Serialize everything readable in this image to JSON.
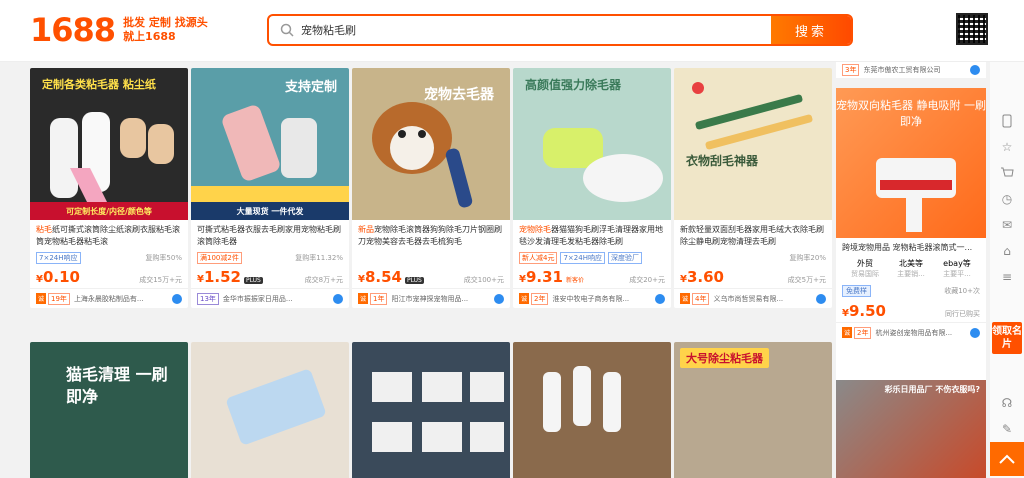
{
  "header": {
    "logo_text": "1688",
    "slogan_line1": "批发 定制 找源头",
    "slogan_line2": "就上1688",
    "search_value": "宠物粘毛刷",
    "search_button": "搜索"
  },
  "products": [
    {
      "image_text": "定制各类粘毛器 粘尘纸",
      "image_sub": "可定制长度/内径/颜色等",
      "title_hl": "粘毛",
      "title_rest": "纸可撕式滚筒除尘纸滚刷衣服粘毛滚筒宠物粘毛器粘毛滚",
      "tags": [
        "7×24H响应"
      ],
      "rate": "复购率50%",
      "price": "0.10",
      "plus": false,
      "sold": "成交15万+元",
      "badge": "诚",
      "years": "19年",
      "shop": "上海永晨胶粘制品有...",
      "img_bg": "#2a2a2a"
    },
    {
      "image_text": "支持定制",
      "image_sub": "大量现货 一件代发",
      "title_hl": "",
      "title_rest": "可撕式粘毛器衣服去毛刷家用宠物粘毛刷滚筒除毛器",
      "tags": [
        "满100减2件"
      ],
      "rate": "复购率11.32%",
      "price": "1.52",
      "plus": true,
      "sold": "成交8万+元",
      "badge": "",
      "years": "13年",
      "shop": "金华市振振家日用品...",
      "img_bg": "#5a9ea8"
    },
    {
      "image_text": "宠物去毛器",
      "image_sub": "",
      "title_hl": "新品",
      "title_rest": "宠物除毛滚筒器狗狗除毛刀片钢圈刷刀宠物美容去毛器去毛梳狗毛",
      "tags": [],
      "rate": "",
      "price": "8.54",
      "plus": true,
      "sold": "成交100+元",
      "badge": "诚",
      "years": "1年",
      "shop": "阳江市宠神探宠物用品...",
      "img_bg": "#c8b48a"
    },
    {
      "image_text": "高颜值强力除毛器",
      "image_sub": "",
      "title_hl": "宠物除毛",
      "title_rest": "器猫猫狗毛刷浮毛清理器家用地毯沙发清理毛发粘毛器除毛刷",
      "tags": [
        "新人减4元",
        "7×24H响应",
        "深度验厂"
      ],
      "rate": "",
      "price": "9.31",
      "plus": false,
      "sold": "成交20+元",
      "badge": "诚",
      "years": "2年",
      "shop": "淮安中牧电子商务有限...",
      "img_bg": "#b8d8cc"
    },
    {
      "image_text": "衣物刮毛神器",
      "image_sub": "",
      "title_hl": "",
      "title_rest": "新款轻量双面刮毛器家用毛绒大衣除毛刷除尘静电刷宠物清理去毛刷",
      "tags": [],
      "rate": "复购率20%",
      "price": "3.60",
      "plus": false,
      "sold": "成交5万+元",
      "badge": "诚",
      "years": "4年",
      "shop": "义乌市尚哲贸易有限...",
      "img_bg": "#f0e6c8"
    },
    {
      "image_text": "猫毛清理 一刷即净",
      "image_sub": "",
      "img_bg": "#2e5a4c"
    },
    {
      "image_text": "",
      "image_sub": "",
      "img_bg": "#e8e0d4"
    },
    {
      "image_text": "",
      "image_sub": "",
      "img_bg": "#3a4a5a"
    },
    {
      "image_text": "",
      "image_sub": "",
      "img_bg": "#8a6a4c"
    },
    {
      "image_text": "大号除尘粘毛器",
      "image_sub": "",
      "img_bg": "#b8a890"
    }
  ],
  "right_col": {
    "top_years": "3年",
    "top_shop": "东莞市傲农工贸有限公司",
    "ad_image_text": "宠物双向粘毛器 静电吸附 一刷即净",
    "title_hl": "宠物",
    "title_rest": "跨境宠物用品 宠物粘毛器滚筒式一...",
    "links": [
      {
        "label": "外贸",
        "sub": "贸易国际"
      },
      {
        "label": "北美等",
        "sub": "主要销..."
      },
      {
        "label": "ebay等",
        "sub": "主要平..."
      }
    ],
    "free_label": "免费样",
    "return_rate": "收藏10+次",
    "price": "9.50",
    "sold": "同行已购买",
    "shop_years": "2年",
    "shop": "杭州姿创宠物用品有限...",
    "second_ad_text": "彩乐日用品厂 不伤衣服吗?"
  },
  "sidebar": {
    "ad_label": "领取名片"
  },
  "colors": {
    "brand": "#ff5000",
    "accent": "#ff6a00"
  }
}
